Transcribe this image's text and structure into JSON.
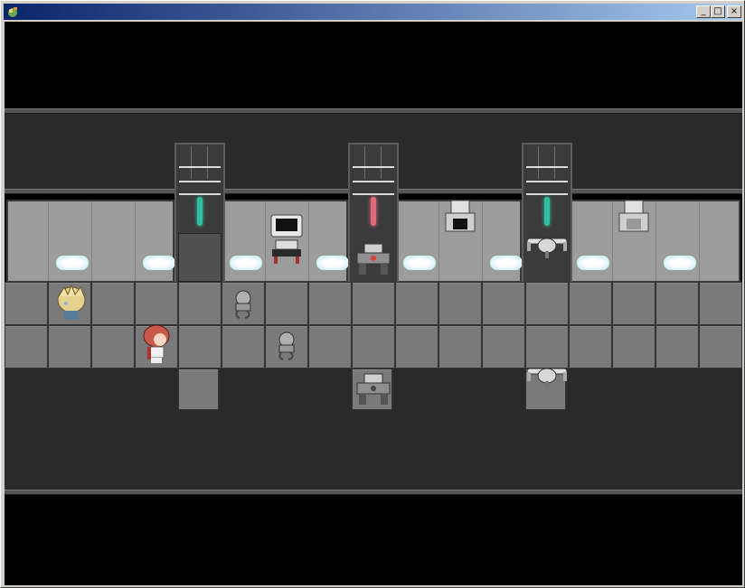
{
  "window": {
    "title": "",
    "buttons": {
      "minimize": "_",
      "maximize": "□",
      "close": "×"
    },
    "app_icon": "rpg-maker-icon"
  },
  "scene": {
    "name": "",
    "characters": [
      {
        "id": "blonde-hero",
        "facing": "down"
      },
      {
        "id": "red-haired-heroine",
        "facing": "right"
      }
    ],
    "enemies": [
      "small-robot",
      "small-robot",
      "mech-walker",
      "mech-walker",
      "hover-drone",
      "hover-drone"
    ],
    "wall_tubes": [
      "#2fbfa0",
      "#e06a7a",
      "#2fbfa0"
    ],
    "machines": [
      "terminal",
      "console-chair",
      "console-chair",
      "console-chair"
    ]
  }
}
